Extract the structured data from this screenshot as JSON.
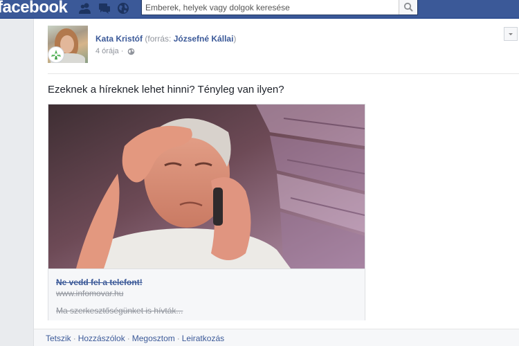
{
  "header": {
    "logo": "facebook",
    "search_placeholder": "Emberek, helyek vagy dolgok keresése",
    "icons": [
      "friend-requests-icon",
      "messages-icon",
      "notifications-globe-icon",
      "search-icon"
    ]
  },
  "post": {
    "author": "Kata Kristóf",
    "source_prefix": "(forrás: ",
    "source_name": "Józsefné Kállai",
    "source_suffix": ")",
    "time": "4 órája",
    "time_separator": "·",
    "privacy_icon": "globe-icon",
    "text": "Ezeknek a híreknek lehet hinni? Tényleg van ilyen?",
    "link": {
      "title": "Ne vedd fel a telefont!",
      "url": "www.infomovar.hu",
      "description": "Ma szerkesztőségünket is hívták..."
    },
    "actions": [
      "Tetszik",
      "Hozzászólok",
      "Megosztom",
      "Leiratkozás"
    ],
    "action_separator": "·"
  },
  "colors": {
    "brand": "#3b5998",
    "background": "#e9ebee",
    "muted_text": "#90949c"
  }
}
